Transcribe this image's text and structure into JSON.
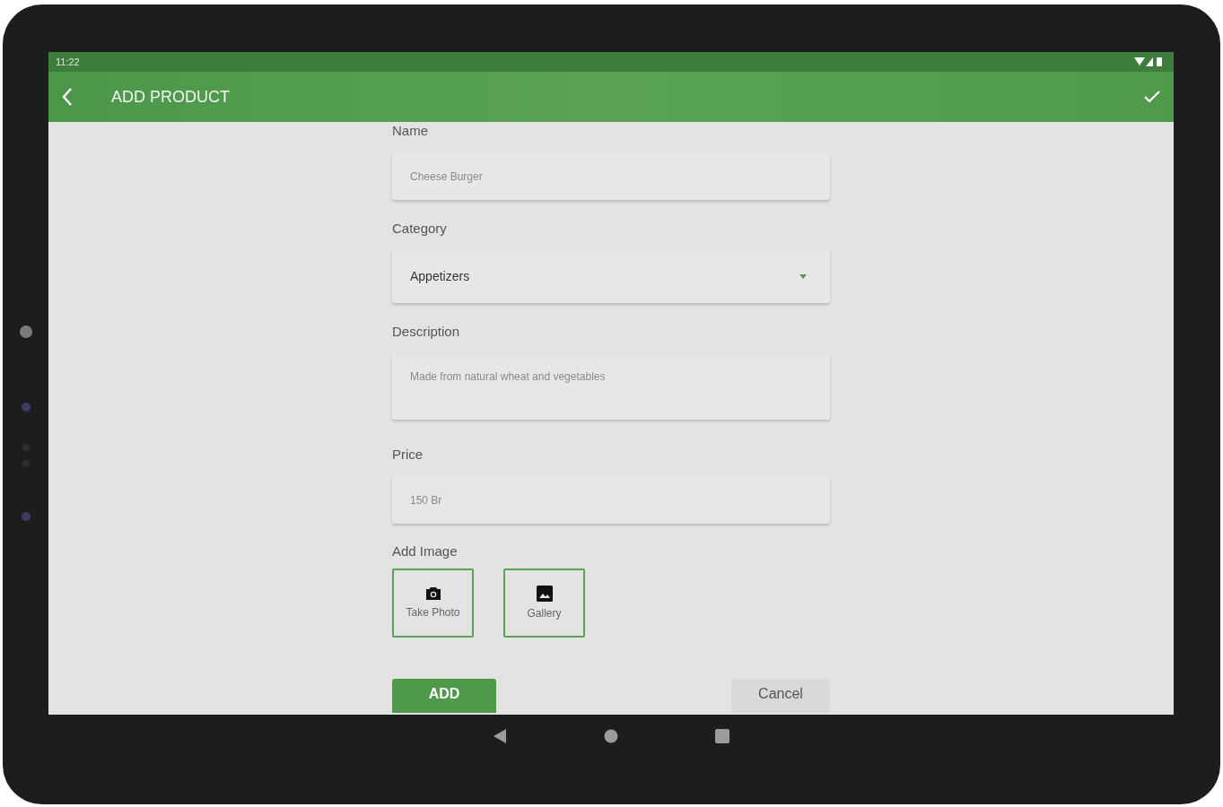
{
  "status_bar": {
    "time": "11:22"
  },
  "app_bar": {
    "title": "ADD PRODUCT"
  },
  "fields": [
    {
      "kind": "text",
      "label": "Name",
      "placeholder": "Cheese Burger"
    },
    {
      "kind": "select",
      "label": "Category",
      "value": "Appetizers"
    },
    {
      "kind": "textarea",
      "label": "Description",
      "placeholder": "Made from natural wheat and vegetables"
    },
    {
      "kind": "text",
      "label": "Price",
      "placeholder": "150 Br"
    }
  ],
  "add_image": {
    "label": "Add Image",
    "options": [
      {
        "kind": "camera",
        "label": "Take Photo"
      },
      {
        "kind": "gallery",
        "label": "Gallery"
      }
    ]
  },
  "actions": [
    {
      "kind": "primary",
      "label": "ADD"
    },
    {
      "kind": "secondary",
      "label": "Cancel"
    }
  ]
}
